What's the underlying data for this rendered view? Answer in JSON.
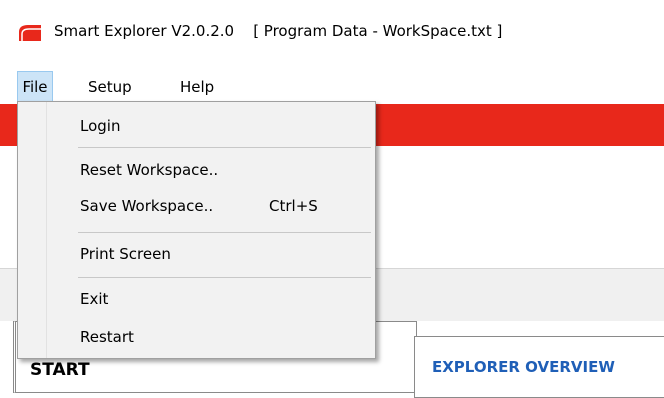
{
  "titlebar": {
    "app_name": "Smart Explorer V2.0.2.0",
    "document": "[ Program Data - WorkSpace.txt ]",
    "icon_color": "#e8281b"
  },
  "menubar": {
    "file": "File",
    "setup": "Setup",
    "help": "Help"
  },
  "file_menu": {
    "login": "Login",
    "reset_workspace": "Reset Workspace..",
    "save_workspace": "Save Workspace..",
    "save_shortcut": "Ctrl+S",
    "print_screen": "Print Screen",
    "exit": "Exit",
    "restart": "Restart"
  },
  "panels": {
    "start": "START",
    "overview": "EXPLORER OVERVIEW"
  },
  "colors": {
    "accent_red": "#e8281b",
    "menu_highlight": "#cce4f7",
    "overview_blue": "#1f5fb7"
  }
}
